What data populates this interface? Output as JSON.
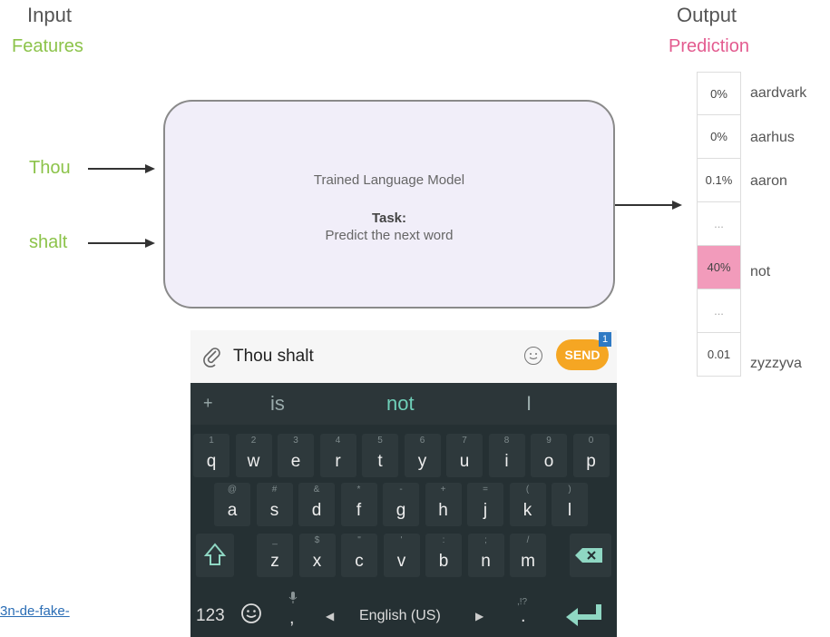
{
  "input": {
    "heading": "Input",
    "subheading": "Features",
    "words": [
      "Thou",
      "shalt"
    ]
  },
  "output": {
    "heading": "Output",
    "subheading": "Prediction"
  },
  "model": {
    "title": "Trained Language Model",
    "task_label": "Task:",
    "task": "Predict the next word"
  },
  "predictions": [
    {
      "prob": "0%",
      "word": "aardvark"
    },
    {
      "prob": "0%",
      "word": "aarhus"
    },
    {
      "prob": "0.1%",
      "word": "aaron"
    },
    {
      "prob": "...",
      "word": ""
    },
    {
      "prob": "40%",
      "word": "not",
      "highlight": true
    },
    {
      "prob": "...",
      "word": ""
    },
    {
      "prob": "0.01",
      "word": "zyzzyva"
    }
  ],
  "phone": {
    "input_text": "Thou shalt",
    "send_label": "SEND",
    "send_badge": "1",
    "suggestions": {
      "plus": "+",
      "left": "is",
      "center": "not",
      "right": "I"
    },
    "row1": [
      {
        "hint": "1",
        "key": "q"
      },
      {
        "hint": "2",
        "key": "w"
      },
      {
        "hint": "3",
        "key": "e"
      },
      {
        "hint": "4",
        "key": "r"
      },
      {
        "hint": "5",
        "key": "t"
      },
      {
        "hint": "6",
        "key": "y"
      },
      {
        "hint": "7",
        "key": "u"
      },
      {
        "hint": "8",
        "key": "i"
      },
      {
        "hint": "9",
        "key": "o"
      },
      {
        "hint": "0",
        "key": "p"
      }
    ],
    "row2": [
      {
        "hint": "@",
        "key": "a"
      },
      {
        "hint": "#",
        "key": "s"
      },
      {
        "hint": "&",
        "key": "d"
      },
      {
        "hint": "*",
        "key": "f"
      },
      {
        "hint": "-",
        "key": "g"
      },
      {
        "hint": "+",
        "key": "h"
      },
      {
        "hint": "=",
        "key": "j"
      },
      {
        "hint": "(",
        "key": "k"
      },
      {
        "hint": ")",
        "key": "l"
      }
    ],
    "row3": [
      {
        "hint": "_",
        "key": "z"
      },
      {
        "hint": "$",
        "key": "x"
      },
      {
        "hint": "\"",
        "key": "c"
      },
      {
        "hint": "'",
        "key": "v"
      },
      {
        "hint": ":",
        "key": "b"
      },
      {
        "hint": ";",
        "key": "n"
      },
      {
        "hint": "/",
        "key": "m"
      }
    ],
    "numbers_key": "123",
    "mic_key": ",",
    "language": "English (US)",
    "punct_key": ".",
    "punct_hint": ",!?"
  },
  "link_text": "3n-de-fake-",
  "colors": {
    "accent_green": "#8cc34a",
    "accent_pink": "#e35b8f",
    "highlight_cell": "#f29bbb",
    "send": "#f5a623",
    "suggestion": "#6fcfb8"
  }
}
